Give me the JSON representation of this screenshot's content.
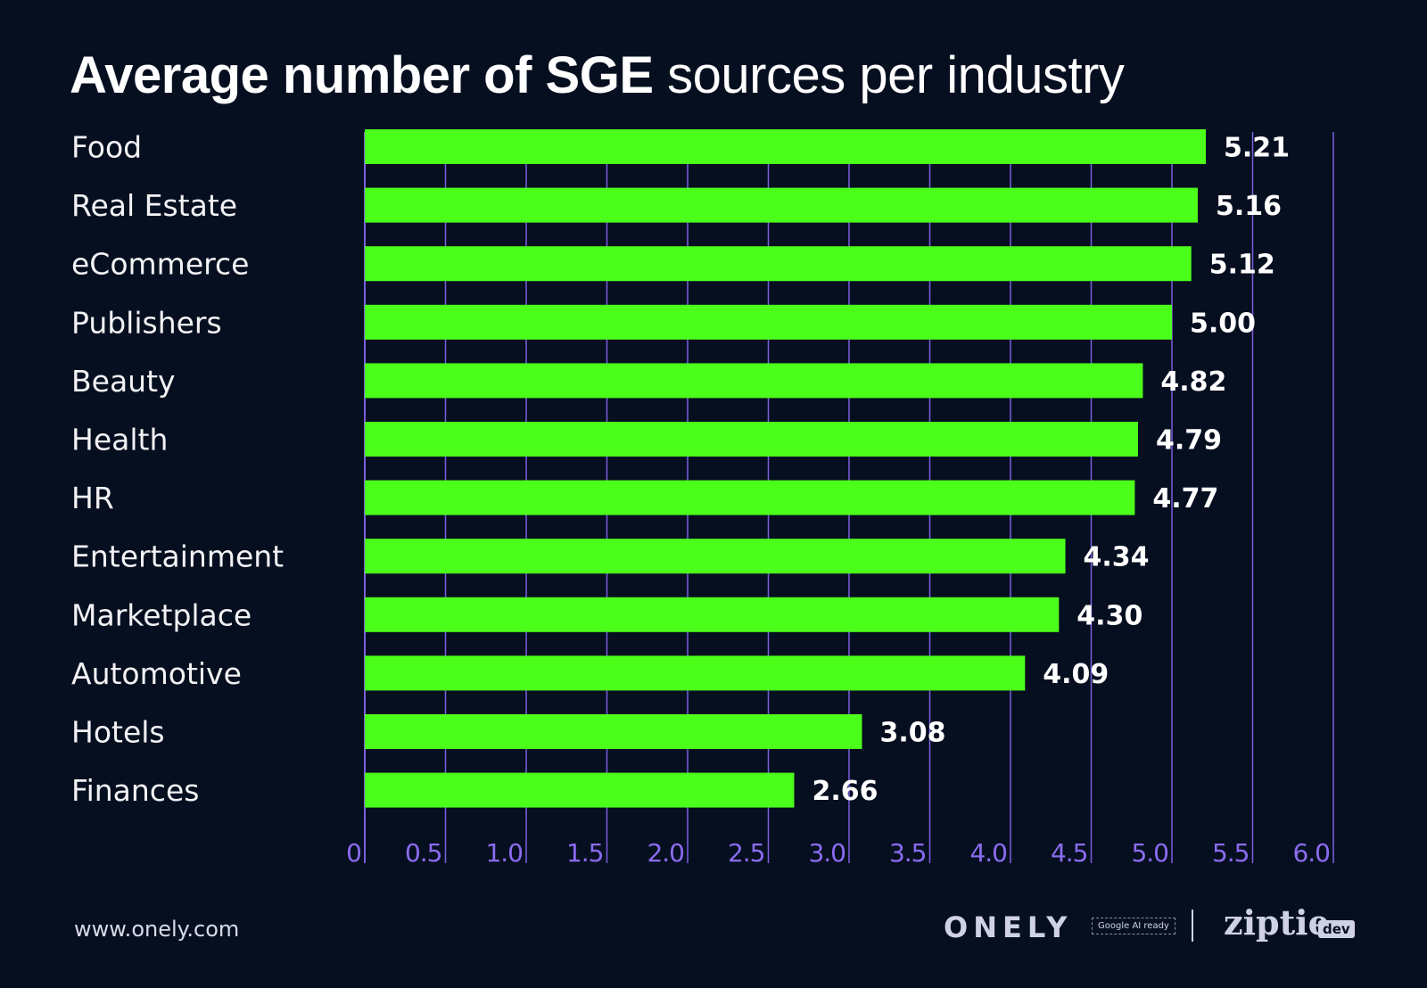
{
  "chart_data": {
    "type": "bar",
    "orientation": "horizontal",
    "title": "Average number of SGE sources per industry",
    "title_parts": {
      "bold": "Average number of SGE",
      "light": "sources per industry"
    },
    "categories": [
      "Food",
      "Real Estate",
      "eCommerce",
      "Publishers",
      "Beauty",
      "Health",
      "HR",
      "Entertainment",
      "Marketplace",
      "Automotive",
      "Hotels",
      "Finances"
    ],
    "values": [
      5.21,
      5.16,
      5.12,
      5.0,
      4.82,
      4.79,
      4.77,
      4.34,
      4.3,
      4.09,
      3.08,
      2.66
    ],
    "value_labels": [
      "5.21",
      "5.16",
      "5.12",
      "5.00",
      "4.82",
      "4.79",
      "4.77",
      "4.34",
      "4.30",
      "4.09",
      "3.08",
      "2.66"
    ],
    "xlabel": "",
    "ylabel": "",
    "xlim": [
      0,
      6.0
    ],
    "x_ticks": [
      0,
      0.5,
      1.0,
      1.5,
      2.0,
      2.5,
      3.0,
      3.5,
      4.0,
      4.5,
      5.0,
      5.5,
      6.0
    ],
    "x_tick_labels": [
      "0",
      "0.5",
      "1.0",
      "1.5",
      "2.0",
      "2.5",
      "3.0",
      "3.5",
      "4.0",
      "4.5",
      "5.0",
      "5.5",
      "6.0"
    ],
    "grid": true,
    "legend": "none",
    "colors": {
      "bar": "#4cff1a",
      "grid": "#7b5fe0",
      "tick_label": "#8a6cf0",
      "background": "#060f20"
    }
  },
  "footer": {
    "url": "www.onely.com",
    "logo_onely": "ONELY",
    "logo_onely_tag": "Google AI ready",
    "logo_ziptie": "ziptie",
    "logo_ziptie_badge": "dev"
  }
}
